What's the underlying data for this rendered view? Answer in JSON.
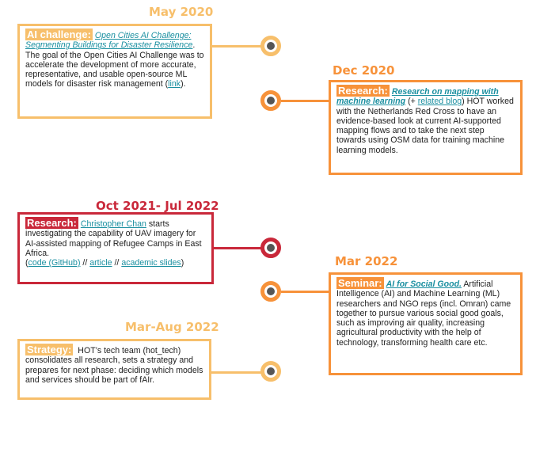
{
  "colors": {
    "light_orange": "#f7bf6b",
    "orange": "#f7923a",
    "red": "#c9283a",
    "text": "#222222",
    "link": "#1a8fa0"
  },
  "events": [
    {
      "date": "May 2020",
      "tag": "AI challenge:",
      "link1": "Open Cities AI Challenge: Segmenting Buildings for Disaster Resilience",
      "text1": ". The goal of the Open Cities AI Challenge was to accelerate the development of more accurate, representative, and usable open-source ML models for disaster risk management (",
      "link2": "link",
      "text2": ")."
    },
    {
      "date": "Dec 2020",
      "tag": "Research:",
      "link1": "Research on mapping with machine learning",
      "text1": " (+ ",
      "link2": "related blog",
      "text2": ") HOT worked with the Netherlands Red Cross to have an evidence-based look at current AI-supported mapping flows and to take the next step towards using OSM data for training machine learning models."
    },
    {
      "date": "Oct 2021- Jul 2022",
      "tag": "Research:",
      "link1": "Christopher Chan",
      "text1": " starts investigating the capability of UAV imagery for AI-assisted mapping of Refugee Camps in East Africa.",
      "link2": "code (GitHub)",
      "sep1": " // ",
      "link3": "article",
      "sep2": " // ",
      "link4": "academic slides",
      "open": "(",
      "close": ")"
    },
    {
      "date": "Mar 2022",
      "tag": "Seminar:",
      "link1": "AI for Social Good.",
      "text1": " Artificial Intelligence (AI) and Machine Learning (ML) researchers and NGO reps (incl. Omran) came together to pursue various social good goals, such as improving air quality, increasing agricultural productivity with the help of technology, transforming health care etc."
    },
    {
      "date": "Mar-Aug 2022",
      "tag": "Strategy:",
      "text1": " HOT’s tech team (hot_tech) consolidates all research, sets a strategy and prepares for next phase: deciding which models and services should be part of fAIr."
    }
  ]
}
